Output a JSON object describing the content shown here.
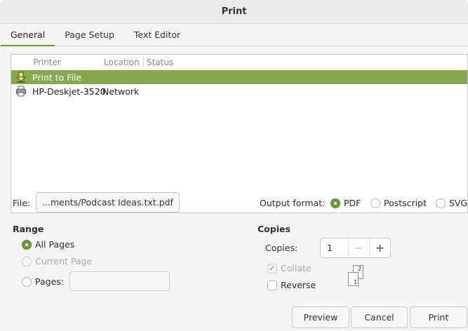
{
  "window": {
    "title": "Print"
  },
  "tabs": [
    {
      "label": "General"
    },
    {
      "label": "Page Setup"
    },
    {
      "label": "Text Editor"
    }
  ],
  "printer_list": {
    "columns": [
      "Printer",
      "Location",
      "Status"
    ],
    "rows": [
      {
        "name": "Print to File",
        "location": "",
        "status": "",
        "icon": "download-icon"
      },
      {
        "name": "HP-Deskjet-3520",
        "location": "Network",
        "status": "",
        "icon": "printer-icon"
      }
    ],
    "selected_index": 0
  },
  "file": {
    "label": "File:",
    "value": "...ments/Podcast Ideas.txt.pdf"
  },
  "output_format": {
    "label": "Output format:",
    "options": [
      "PDF",
      "Postscript",
      "SVG"
    ],
    "selected": "PDF"
  },
  "range": {
    "title": "Range",
    "all_pages": "All Pages",
    "current_page": "Current Page",
    "pages": "Pages:",
    "selected": "All Pages",
    "pages_value": ""
  },
  "copies": {
    "title": "Copies",
    "label": "Copies:",
    "value": "1",
    "minus": "−",
    "plus": "+",
    "collate": "Collate",
    "collate_checked": true,
    "reverse": "Reverse",
    "reverse_checked": false,
    "sheet_front": "1",
    "sheet_back": "2"
  },
  "buttons": {
    "preview": "Preview",
    "cancel": "Cancel",
    "print": "Print"
  },
  "colors": {
    "accent": "#86a94d",
    "radio_on": "#6a9a38"
  }
}
